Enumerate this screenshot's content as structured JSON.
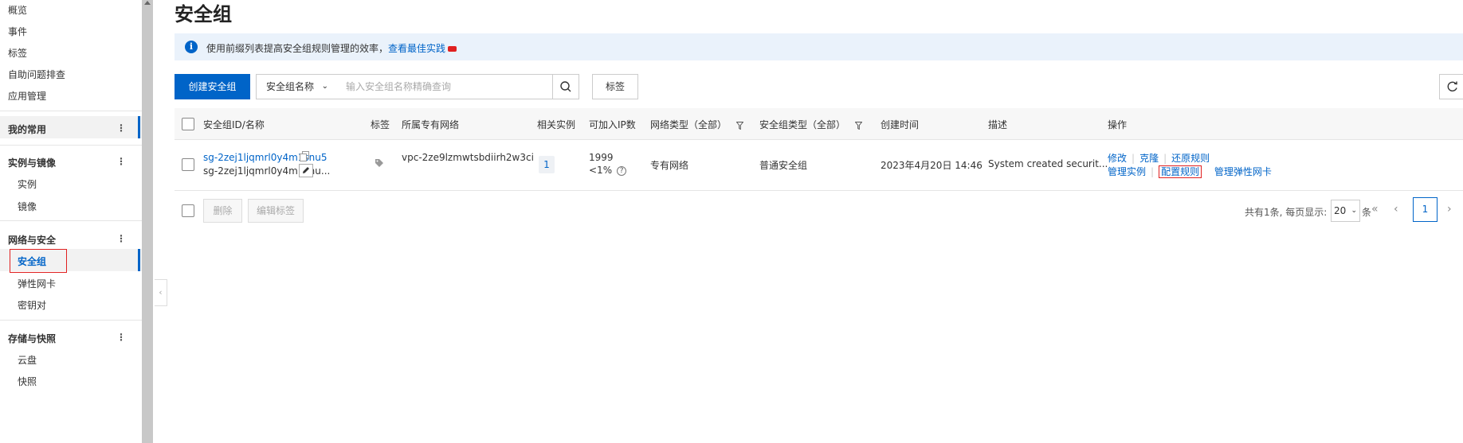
{
  "sidebar": {
    "top_items": [
      "概览",
      "事件",
      "标签",
      "自助问题排查",
      "应用管理"
    ],
    "favorites_title": "我的常用",
    "groups": [
      {
        "title": "实例与镜像",
        "items": [
          "实例",
          "镜像"
        ]
      },
      {
        "title": "网络与安全",
        "items": [
          "安全组",
          "弹性网卡",
          "密钥对"
        ]
      },
      {
        "title": "存储与快照",
        "items": [
          "云盘",
          "快照"
        ]
      }
    ],
    "active_item": "安全组",
    "more_icon": "⋮"
  },
  "page": {
    "title": "安全组"
  },
  "tip": {
    "text": "使用前缀列表提高安全组规则管理的效率，",
    "link": "查看最佳实践",
    "icon": "info-icon",
    "icon_glyph": "i"
  },
  "toolbar": {
    "create_label": "创建安全组",
    "search_field": "安全组名称",
    "search_placeholder": "输入安全组名称精确查询",
    "tag_label": "标签",
    "search_icon": "search-icon",
    "refresh_icon": "refresh-icon"
  },
  "table": {
    "columns": [
      "安全组ID/名称",
      "标签",
      "所属专有网络",
      "相关实例",
      "可加入IP数",
      "网络类型（全部）",
      "安全组类型（全部）",
      "创建时间",
      "描述",
      "操作"
    ],
    "rows": [
      {
        "id": "sg-2zej1ljqmrl0y4m1snu5",
        "name": "sg-2zej1ljqmrl0y4m1snu...",
        "vpc": "vpc-2ze9lzmwtsbdiirh2w3ci",
        "instances": "1",
        "ip_count": "1999",
        "ip_percent": "<1%",
        "network_type": "专有网络",
        "sg_type": "普通安全组",
        "created": "2023年4月20日 14:46",
        "description": "System created securit...",
        "actions": {
          "modify": "修改",
          "clone": "克隆",
          "restore": "还原规则",
          "manage_instances": "管理实例",
          "configure_rules": "配置规则",
          "manage_eni": "管理弹性网卡"
        }
      }
    ]
  },
  "footer": {
    "delete_label": "删除",
    "edit_tags_label": "编辑标签",
    "summary": "共有1条, 每页显示:",
    "page_size": "20",
    "unit": "条",
    "current_page": "1",
    "first_glyph": "«",
    "prev_glyph": "‹",
    "next_glyph": "›"
  },
  "colors": {
    "accent": "#0064c8",
    "highlight": "#e02020"
  }
}
